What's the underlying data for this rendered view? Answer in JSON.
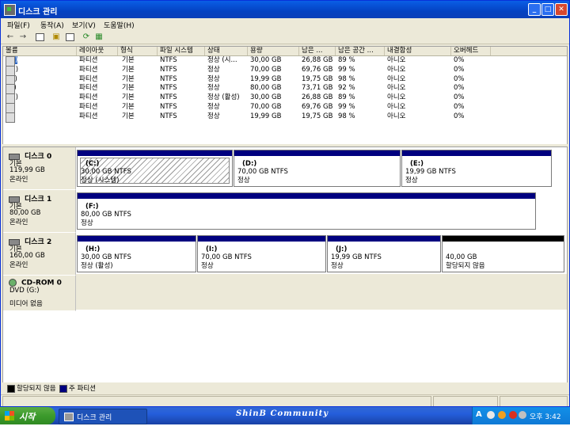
{
  "window": {
    "title": "디스크 관리"
  },
  "menu": [
    "파일(F)",
    "동작(A)",
    "보기(V)",
    "도움말(H)"
  ],
  "toolbar": {
    "icons": [
      "back-icon",
      "forward-icon",
      "console-tree-icon",
      "properties-icon",
      "help-icon",
      "refresh-icon",
      "export-icon"
    ]
  },
  "columns": [
    "볼륨",
    "레이아웃",
    "형식",
    "파일 시스템",
    "상태",
    "용량",
    "남은 ...",
    "남은 공간 ...",
    "내결함성",
    "오버헤드"
  ],
  "volumes": [
    [
      "(C:)",
      "파티션",
      "기본",
      "NTFS",
      "정상 (시...",
      "30,00 GB",
      "26,88 GB",
      "89 %",
      "아니오",
      "0%"
    ],
    [
      "(D:)",
      "파티션",
      "기본",
      "NTFS",
      "정상",
      "70,00 GB",
      "69,76 GB",
      "99 %",
      "아니오",
      "0%"
    ],
    [
      "(E:)",
      "파티션",
      "기본",
      "NTFS",
      "정상",
      "19,99 GB",
      "19,75 GB",
      "98 %",
      "아니오",
      "0%"
    ],
    [
      "(F:)",
      "파티션",
      "기본",
      "NTFS",
      "정상",
      "80,00 GB",
      "73,71 GB",
      "92 %",
      "아니오",
      "0%"
    ],
    [
      "(H:)",
      "파티션",
      "기본",
      "NTFS",
      "정상 (활성)",
      "30,00 GB",
      "26,88 GB",
      "89 %",
      "아니오",
      "0%"
    ],
    [
      "(I:)",
      "파티션",
      "기본",
      "NTFS",
      "정상",
      "70,00 GB",
      "69,76 GB",
      "99 %",
      "아니오",
      "0%"
    ],
    [
      "(J:)",
      "파티션",
      "기본",
      "NTFS",
      "정상",
      "19,99 GB",
      "19,75 GB",
      "98 %",
      "아니오",
      "0%"
    ]
  ],
  "disks": [
    {
      "name": "디스크 0",
      "type": "기본",
      "size": "119,99 GB",
      "status": "온라인",
      "partitions": [
        {
          "label": "(C:)",
          "size": "30,00 GB NTFS",
          "status": "정상 (시스템)"
        },
        {
          "label": "(D:)",
          "size": "70,00 GB NTFS",
          "status": "정상"
        },
        {
          "label": "(E:)",
          "size": "19,99 GB NTFS",
          "status": "정상"
        }
      ]
    },
    {
      "name": "디스크 1",
      "type": "기본",
      "size": "80,00 GB",
      "status": "온라인",
      "partitions": [
        {
          "label": "(F:)",
          "size": "80,00 GB NTFS",
          "status": "정상"
        }
      ]
    },
    {
      "name": "디스크 2",
      "type": "기본",
      "size": "160,00 GB",
      "status": "온라인",
      "partitions": [
        {
          "label": "(H:)",
          "size": "30,00 GB NTFS",
          "status": "정상 (활성)"
        },
        {
          "label": "(I:)",
          "size": "70,00 GB NTFS",
          "status": "정상"
        },
        {
          "label": "(J:)",
          "size": "19,99 GB NTFS",
          "status": "정상"
        },
        {
          "label": "",
          "size": "40,00 GB",
          "status": "할당되지 않음"
        }
      ]
    }
  ],
  "cdrom": {
    "name": "CD-ROM 0",
    "drive": "DVD (G:)",
    "status": "미디어 없음"
  },
  "legend": {
    "unallocated": "할당되지 않음",
    "primary": "주 파티션",
    "unallocated_color": "#000000",
    "primary_color": "#00007f"
  },
  "taskbar": {
    "start": "시작",
    "task": "디스크 관리",
    "banner": "ShinB Community",
    "clock": "오후 3:42",
    "ime": "A"
  }
}
